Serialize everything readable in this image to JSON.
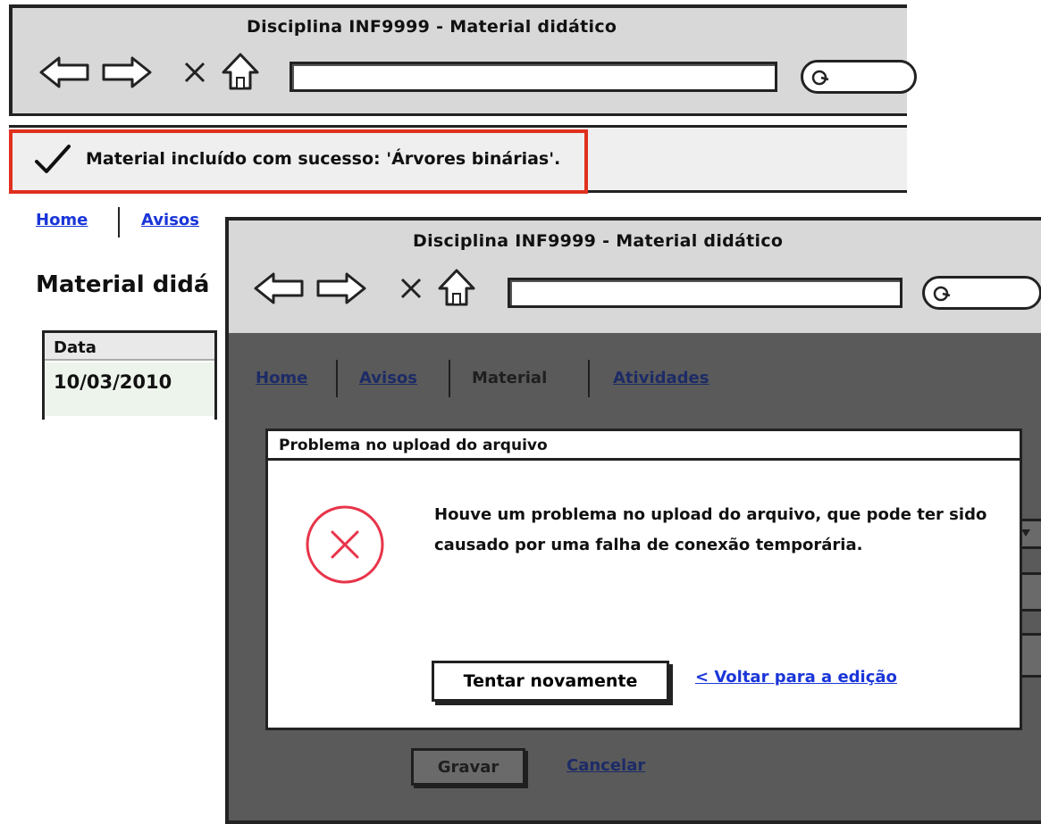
{
  "back_window": {
    "title": "Disciplina INF9999 - Material didático",
    "notice": {
      "text": "Material incluído com sucesso: 'Árvores binárias'."
    },
    "nav": {
      "home": "Home",
      "avisos": "Avisos"
    },
    "heading": "Material didá",
    "table": {
      "column": "Data",
      "rows": [
        "10/03/2010"
      ]
    }
  },
  "front_window": {
    "title": "Disciplina INF9999 - Material didático",
    "nav": {
      "home": "Home",
      "avisos": "Avisos",
      "material": "Material",
      "atividades": "Atividades"
    },
    "form": {
      "save": "Gravar",
      "cancel": "Cancelar"
    },
    "dialog": {
      "title": "Problema no upload do arquivo",
      "message": "Houve um problema no upload do arquivo, que pode ter sido causado por uma falha de conexão temporária.",
      "retry": "Tentar novamente",
      "back": "< Voltar para a edição"
    }
  },
  "colors": {
    "highlight": "#e0301e",
    "error_icon": "#e8344a",
    "link": "#1a35d8",
    "overlay": "#5a5a5a"
  }
}
